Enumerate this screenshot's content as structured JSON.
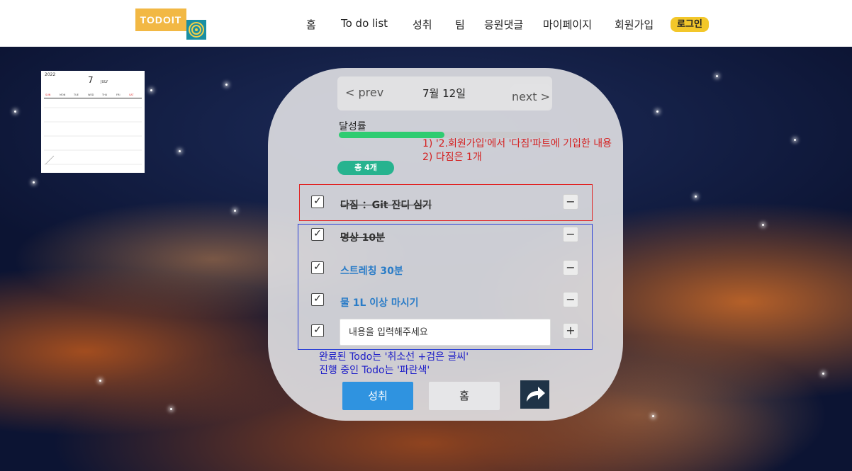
{
  "header": {
    "logo_text": "TODOIT",
    "nav": [
      "홈",
      "To do list",
      "성취",
      "팀",
      "응원댓글",
      "마이페이지",
      "회원가입"
    ],
    "login_label": "로그인"
  },
  "calendar": {
    "year": "2022",
    "month_num": "7",
    "month_name": "JULY",
    "weekdays": [
      "SUN",
      "MON",
      "TUE",
      "WED",
      "THU",
      "FRI",
      "SAT"
    ]
  },
  "date_nav": {
    "prev_label": "< prev",
    "date_label": "7월 12일",
    "next_label": "next >"
  },
  "achievement": {
    "label": "달성률",
    "progress_fraction": 0.5
  },
  "total_badge": "총 4개",
  "annotations": {
    "red_note": "1) '2.회원가입'에서 '다짐'파트에 기입한 내용\n2) 다짐은 1개",
    "blue_note": "완료된 Todo는 '취소선 +검은 글씨'\n진행 중인 Todo는 '파란색'"
  },
  "todos": [
    {
      "text": "다짐 ：Git 잔디 심기",
      "status": "done",
      "check": "✓",
      "action": "−"
    },
    {
      "text": "명상 10분",
      "status": "done",
      "check": "✓",
      "action": "−"
    },
    {
      "text": "스트레칭 30분",
      "status": "active",
      "check": "✓",
      "action": "−"
    },
    {
      "text": "물 1L 이상 마시기",
      "status": "active",
      "check": "✓",
      "action": "−"
    }
  ],
  "new_todo": {
    "placeholder": "내용을 입력해주세요",
    "check": "✓",
    "add_label": "+"
  },
  "buttons": {
    "achievement_label": "성취",
    "home_label": "홈",
    "share_icon": "share-arrow-icon"
  },
  "colors": {
    "accent_blue": "#2f93e0",
    "progress_green": "#2ecc71",
    "badge_teal": "#27b38f",
    "login_yellow": "#f3c72a",
    "note_red": "#d42020",
    "note_blue": "#2020c8"
  }
}
